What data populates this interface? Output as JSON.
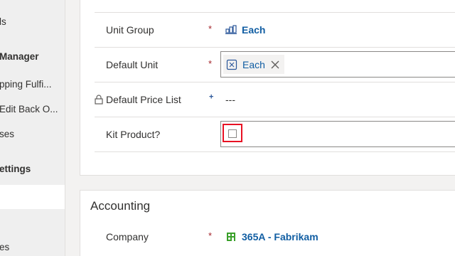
{
  "sidebar": {
    "items": [
      {
        "label": "ls",
        "bold": false
      },
      {
        "label": "Manager",
        "bold": true
      },
      {
        "label": "pping Fulfi...",
        "bold": false
      },
      {
        "label": "Edit Back O...",
        "bold": false
      },
      {
        "label": "ses",
        "bold": false
      },
      {
        "label": "ettings",
        "bold": true
      },
      {
        "label": "es",
        "bold": false
      }
    ]
  },
  "product_form": {
    "unit_group": {
      "label": "Unit Group",
      "required": "*",
      "value": "Each",
      "icon": "unit-group-icon"
    },
    "default_unit": {
      "label": "Default Unit",
      "required": "*",
      "value": "Each",
      "icon": "unit-icon",
      "remove_icon": "close-icon"
    },
    "default_price_list": {
      "label": "Default Price List",
      "recommended": "+",
      "value": "---",
      "icon": "lock-icon"
    },
    "kit_product": {
      "label": "Kit Product?",
      "checked": false
    }
  },
  "accounting": {
    "title": "Accounting",
    "company": {
      "label": "Company",
      "required": "*",
      "value": "365A - Fabrikam",
      "icon": "company-icon"
    }
  },
  "colors": {
    "required": "#a4262c",
    "link": "#115ea3",
    "highlight": "#e81123",
    "green_icon": "#3aa02a"
  }
}
